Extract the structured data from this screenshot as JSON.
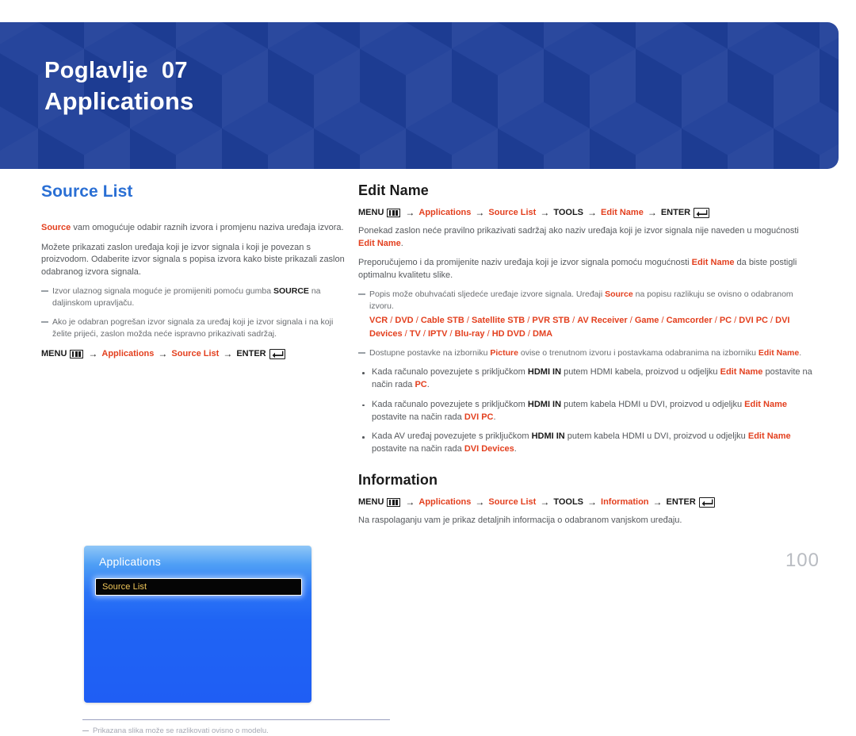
{
  "banner": {
    "chapter": "Poglavlje  07",
    "title": "Applications"
  },
  "left": {
    "heading": "Source List",
    "intro_bold": "Source",
    "intro_rest": " vam omogućuje odabir raznih izvora i promjenu naziva uređaja izvora.",
    "para2": "Možete prikazati zaslon uređaja koji je izvor signala i koji je povezan s proizvodom. Odaberite izvor signala s popisa izvora kako biste prikazali zaslon odabranog izvora signala.",
    "note1_pre": "Izvor ulaznog signala moguće je promijeniti pomoću gumba ",
    "note1_bold": "SOURCE",
    "note1_post": " na daljinskom upravljaču.",
    "note2": "Ako je odabran pogrešan izvor signala za uređaj koji je izvor signala i na koji želite prijeći, zaslon možda neće ispravno prikazivati sadržaj.",
    "menupath": {
      "menu": "MENU",
      "menu_icon": "menu-bars-icon",
      "step1": "Applications",
      "step2": "Source List",
      "enter": "ENTER",
      "enter_icon": "enter-return-icon",
      "arrow": "→"
    },
    "tv": {
      "title": "Applications",
      "selected_row": "Source List"
    },
    "footnote": "Prikazana slika može se razlikovati ovisno o modelu."
  },
  "right": {
    "edit_name": {
      "heading": "Edit Name",
      "menupath": {
        "menu": "MENU",
        "menu_icon": "menu-bars-icon",
        "step1": "Applications",
        "step2": "Source List",
        "step3": "TOOLS",
        "step4": "Edit Name",
        "enter": "ENTER",
        "enter_icon": "enter-return-icon",
        "arrow": "→"
      },
      "para1_pre": "Ponekad zaslon neće pravilno prikazivati sadržaj ako naziv uređaja koji je izvor signala nije naveden u mogućnosti ",
      "para1_bold": "Edit Name",
      "para1_post": ".",
      "para2_pre": "Preporučujemo i da promijenite naziv uređaja koji je izvor signala pomoću mogućnosti ",
      "para2_bold": "Edit Name",
      "para2_post": " da biste postigli optimalnu kvalitetu slike.",
      "note1_pre": "Popis može obuhvaćati sljedeće uređaje izvore signala. Uređaji ",
      "note1_bold": "Source",
      "note1_post": " na popisu razlikuju se ovisno o odabranom izvoru.",
      "device_list": [
        "VCR",
        "DVD",
        "Cable STB",
        "Satellite STB",
        "PVR STB",
        "AV Receiver",
        "Game",
        "Camcorder",
        "PC",
        "DVI PC",
        "DVI Devices",
        "TV",
        "IPTV",
        "Blu-ray",
        "HD DVD",
        "DMA"
      ],
      "note2_pre": "Dostupne postavke na izborniku ",
      "note2_bold1": "Picture",
      "note2_mid": " ovise o trenutnom izvoru i postavkama odabranima na izborniku ",
      "note2_bold2": "Edit Name",
      "note2_post": ".",
      "bullets": [
        {
          "p1": "Kada računalo povezujete s priključkom ",
          "b1": "HDMI IN",
          "p2": " putem HDMI kabela, proizvod u odjeljku ",
          "b2": "Edit Name",
          "p3": " postavite na način rada ",
          "b3": "PC",
          "p4": "."
        },
        {
          "p1": "Kada računalo povezujete s priključkom ",
          "b1": "HDMI IN",
          "p2": " putem kabela HDMI u DVI, proizvod u odjeljku ",
          "b2": "Edit Name",
          "p3": " postavite na način rada ",
          "b3": "DVI PC",
          "p4": "."
        },
        {
          "p1": "Kada AV uređaj povezujete s priključkom ",
          "b1": "HDMI IN",
          "p2": " putem kabela HDMI u DVI, proizvod u odjeljku ",
          "b2": "Edit Name",
          "p3": " postavite na način rada ",
          "b3": "DVI Devices",
          "p4": "."
        }
      ]
    },
    "information": {
      "heading": "Information",
      "menupath": {
        "menu": "MENU",
        "menu_icon": "menu-bars-icon",
        "step1": "Applications",
        "step2": "Source List",
        "step3": "TOOLS",
        "step4": "Information",
        "enter": "ENTER",
        "enter_icon": "enter-return-icon",
        "arrow": "→"
      },
      "para": "Na raspolaganju vam je prikaz detaljnih informacija o odabranom vanjskom uređaju."
    }
  },
  "page_number": "100",
  "colors": {
    "banner_blue": "#1f3f99",
    "heading_blue": "#2a6fd4",
    "accent_orange": "#e3401f",
    "tv_blue": "#1f5ef4",
    "tv_highlight_text": "#f2c85a",
    "muted_text": "#55585c",
    "page_number_gray": "#b9bcc2"
  }
}
